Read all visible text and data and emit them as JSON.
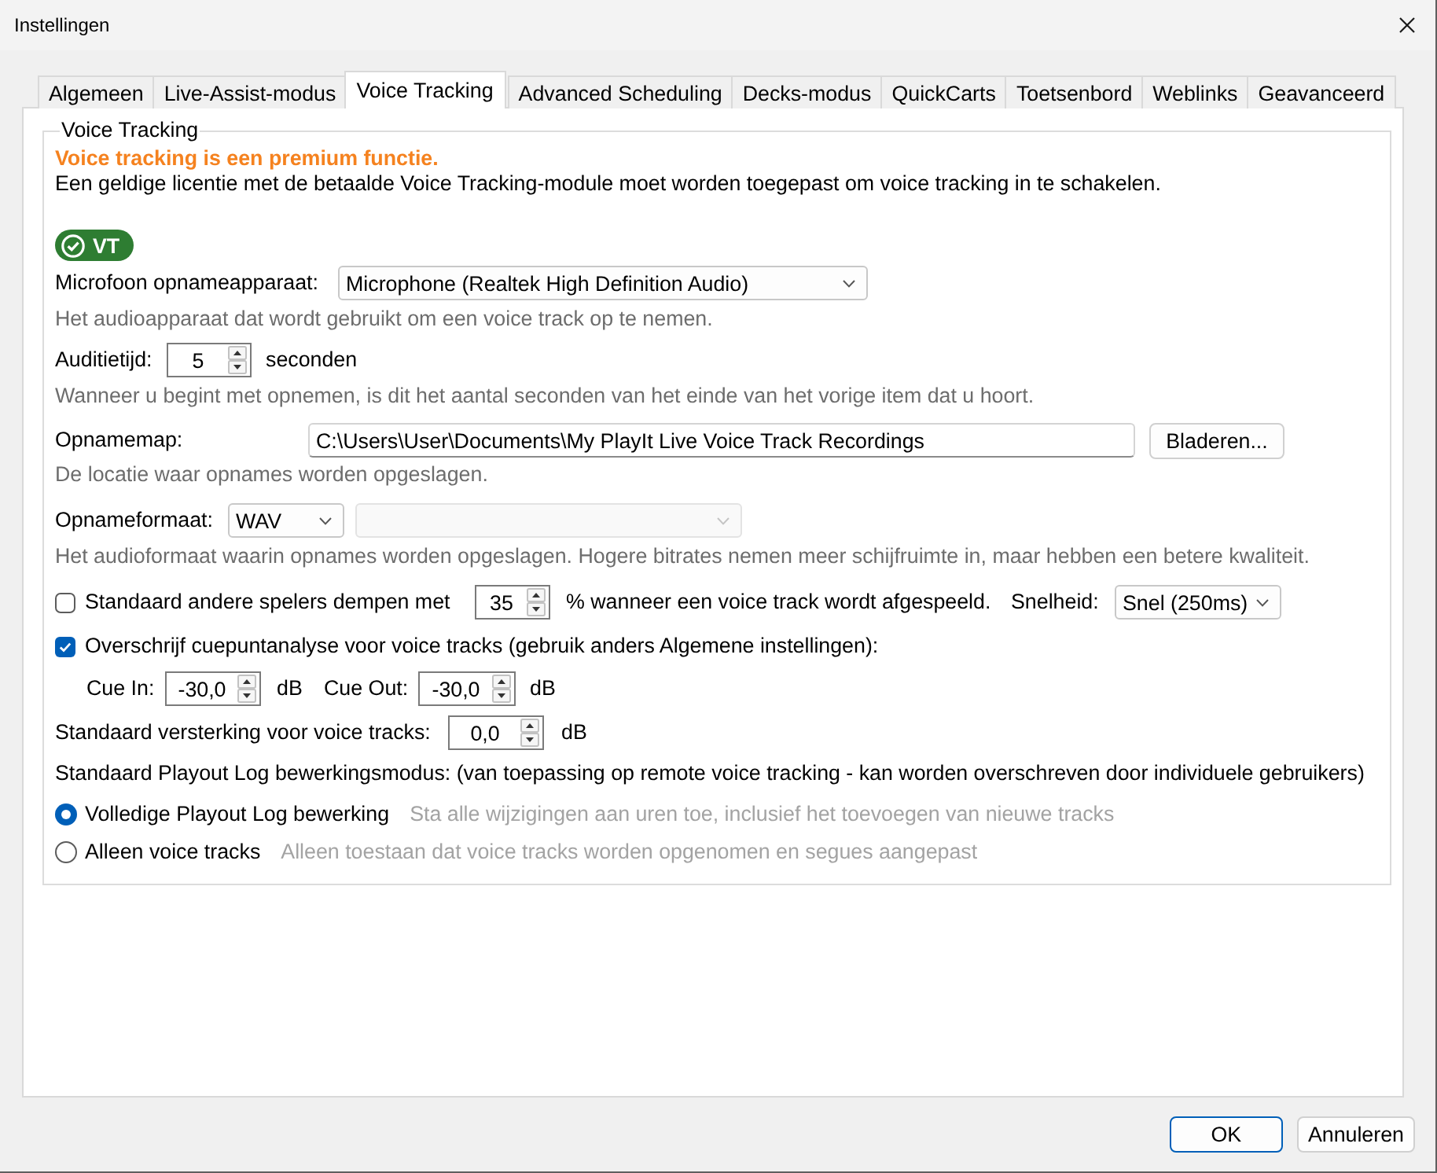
{
  "window": {
    "title": "Instellingen"
  },
  "tabs": [
    {
      "label": "Algemeen",
      "selected": false
    },
    {
      "label": "Live-Assist-modus",
      "selected": false
    },
    {
      "label": "Voice Tracking",
      "selected": true
    },
    {
      "label": "Advanced Scheduling",
      "selected": false
    },
    {
      "label": "Decks-modus",
      "selected": false
    },
    {
      "label": "QuickCarts",
      "selected": false
    },
    {
      "label": "Toetsenbord",
      "selected": false
    },
    {
      "label": "Weblinks",
      "selected": false
    },
    {
      "label": "Geavanceerd",
      "selected": false
    }
  ],
  "page": {
    "group_title": "Voice Tracking",
    "notice": "Voice tracking is een premium functie.",
    "license_text": "Een geldige licentie met de betaalde Voice Tracking-module moet worden toegepast om voice tracking in te schakelen.",
    "badge": {
      "label": "VT"
    },
    "microphone": {
      "label": "Microfoon opnameapparaat:",
      "value": "Microphone (Realtek High Definition Audio)",
      "hint": "Het audioapparaat dat wordt gebruikt om een voice track op te nemen."
    },
    "audition": {
      "label": "Auditietijd:",
      "value": "5",
      "unit": "seconden",
      "hint": "Wanneer u begint met opnemen, is dit het aantal seconden van het einde van het vorige item dat u hoort."
    },
    "folder": {
      "label": "Opnamemap:",
      "value": "C:\\Users\\User\\Documents\\My PlayIt Live Voice Track Recordings",
      "button": "Bladeren...",
      "hint": "De locatie waar opnames worden opgeslagen."
    },
    "format": {
      "label": "Opnameformaat:",
      "value": "WAV",
      "quality_disabled": true,
      "hint": "Het audioformaat waarin opnames worden opgeslagen. Hogere bitrates nemen meer schijfruimte in, maar hebben een betere kwaliteit."
    },
    "duck": {
      "checked": false,
      "label": "Standaard andere spelers dempen met",
      "value": "35",
      "suffix": "% wanneer een voice track wordt afgespeeld.",
      "speed_label": "Snelheid:",
      "speed_value": "Snel (250ms)"
    },
    "cue_override": {
      "checked": true,
      "label": "Overschrijf cuepuntanalyse voor voice tracks (gebruik anders Algemene instellingen):",
      "cue_in_label": "Cue In:",
      "cue_in_value": "-30,0",
      "cue_in_unit": "dB",
      "cue_out_label": "Cue Out:",
      "cue_out_value": "-30,0",
      "cue_out_unit": "dB"
    },
    "gain": {
      "label": "Standaard versterking voor voice tracks:",
      "value": "0,0",
      "unit": "dB"
    },
    "edit_mode": {
      "label": "Standaard Playout Log bewerkingsmodus: (van toepassing op remote voice tracking - kan worden overschreven door individuele gebruikers)",
      "options": [
        {
          "label": "Volledige Playout Log bewerking",
          "description": "Sta alle wijzigingen aan uren toe, inclusief het toevoegen van nieuwe tracks",
          "selected": true
        },
        {
          "label": "Alleen voice tracks",
          "description": "Alleen toestaan dat voice tracks worden opgenomen en segues aangepast",
          "selected": false
        }
      ]
    }
  },
  "buttons": [
    {
      "label": "OK",
      "default": true
    },
    {
      "label": "Annuleren",
      "default": false
    }
  ]
}
